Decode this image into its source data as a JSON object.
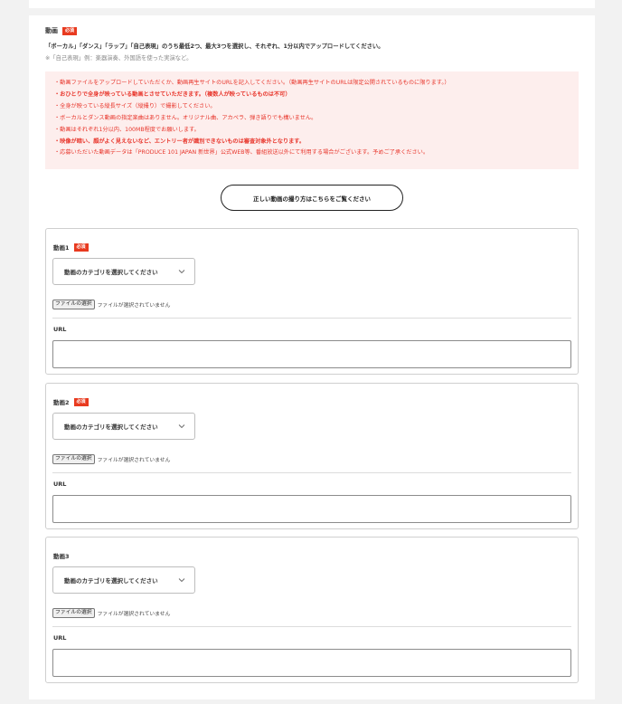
{
  "section": {
    "title": "動画",
    "required_badge": "必須",
    "description": "「ボーカル」「ダンス」「ラップ」「自己表現」のうち最低2つ、最大3つを選択し、それぞれ、1分以内でアップロードしてください。",
    "note": "※「自己表現」例：楽器演奏、外国語を使った実演など。"
  },
  "notice": {
    "lines": [
      "・動画ファイルをアップロードしていただくか、動画再生サイトのURLを記入してください。（動画再生サイトのURLは限定公開されているものに限ります。）",
      "・おひとりで全身が映っている動画とさせていただきます。（複数人が映っているものは不可）",
      "・全身が映っている縦長サイズ（縦撮り）で撮影してください。",
      "・ボーカルとダンス動画の指定楽曲はありません。オリジナル曲、アカペラ、弾き語りでも構いません。",
      "・動画はそれぞれ1分以内、100MB程度でお願いします。",
      "・映像が暗い、顔がよく見えないなど、エントリー者が識別できないものは審査対象外となります。",
      "・応募いただいた動画データは「PRODUCE 101 JAPAN 新世界」公式WEB等、番組放送以外にて利用する場合がございます。予めご了承ください。"
    ]
  },
  "howto_button": "正しい動画の撮り方はこちらをご覧ください",
  "videos": [
    {
      "label": "動画1",
      "required_badge": "必須",
      "select_value": "動画のカテゴリを選択してください",
      "file_button": "ファイルの選択",
      "file_status": "ファイルが選択されていません",
      "url_label": "URL",
      "url_value": ""
    },
    {
      "label": "動画2",
      "required_badge": "必須",
      "select_value": "動画のカテゴリを選択してください",
      "file_button": "ファイルの選択",
      "file_status": "ファイルが選択されていません",
      "url_label": "URL",
      "url_value": ""
    },
    {
      "label": "動画3",
      "select_value": "動画のカテゴリを選択してください",
      "file_button": "ファイルの選択",
      "file_status": "ファイルが選択されていません",
      "url_label": "URL",
      "url_value": ""
    }
  ],
  "colors": {
    "accent_red": "#e83a1f",
    "notice_bg": "#fdeeed",
    "notice_text": "#e8362c"
  }
}
